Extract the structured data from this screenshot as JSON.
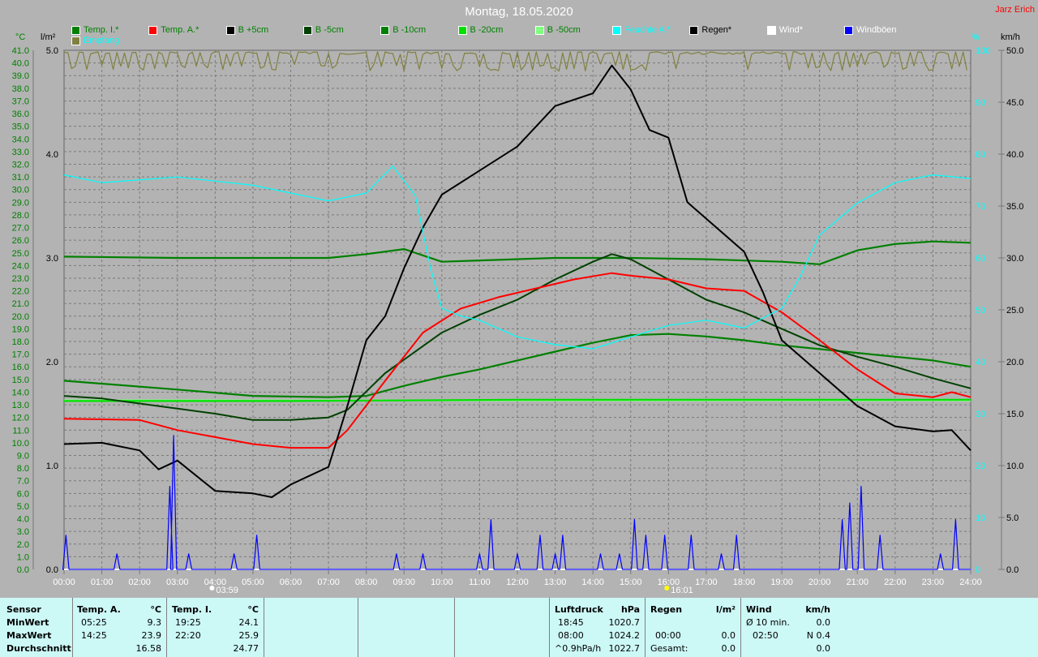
{
  "title": "Montag, 18.05.2020",
  "author": "Jarz Erich",
  "legend": [
    {
      "label": "Temp. I.*",
      "color": "#008000",
      "text_color": "#008000"
    },
    {
      "label": "Temp. A.*",
      "color": "#ff0000",
      "text_color": "#008000"
    },
    {
      "label": "B +5cm",
      "color": "#000000",
      "text_color": "#008000"
    },
    {
      "label": "B -5cm",
      "color": "#004000",
      "text_color": "#008000"
    },
    {
      "label": "B -10cm",
      "color": "#008000",
      "text_color": "#008000"
    },
    {
      "label": "B -20cm",
      "color": "#00e000",
      "text_color": "#008000"
    },
    {
      "label": "B -50cm",
      "color": "#80ff80",
      "text_color": "#008000"
    },
    {
      "label": "Feuchte A.*",
      "color": "#00ffff",
      "text_color": "#00ffff"
    },
    {
      "label": "Regen*",
      "color": "#000000",
      "text_color": "#000000"
    },
    {
      "label": "Wind*",
      "color": "#ffffff",
      "text_color": "#ffffff"
    },
    {
      "label": "Windböen",
      "color": "#0000ff",
      "text_color": "#ffffff"
    },
    {
      "label": "Empfang",
      "color": "#808040",
      "text_color": "#00ffff"
    }
  ],
  "chart_data": {
    "type": "line",
    "title": "Montag, 18.05.2020",
    "xlabel": "",
    "x_ticks": [
      "00:00",
      "01:00",
      "02:00",
      "03:00",
      "04:00",
      "05:00",
      "06:00",
      "07:00",
      "08:00",
      "09:00",
      "10:00",
      "11:00",
      "12:00",
      "13:00",
      "14:00",
      "15:00",
      "16:00",
      "17:00",
      "18:00",
      "19:00",
      "20:00",
      "21:00",
      "22:00",
      "23:00",
      "24:00"
    ],
    "xlim": [
      0,
      24
    ],
    "grid": true,
    "axes": {
      "temp": {
        "unit": "°C",
        "range": [
          0,
          41
        ],
        "step": 1,
        "color": "#008000"
      },
      "rain": {
        "unit": "l/m²",
        "range": [
          0,
          5
        ],
        "step": 1,
        "color": "#000000"
      },
      "humidity": {
        "unit": "%",
        "range": [
          0,
          100
        ],
        "step": 10,
        "color": "#00ffff"
      },
      "wind": {
        "unit": "km/h",
        "range": [
          0,
          50
        ],
        "step": 5,
        "color": "#000000"
      }
    },
    "sun": [
      {
        "label": "03:59",
        "hour": 3.98,
        "type": "sunrise"
      },
      {
        "label": "16:01",
        "hour": 16.02,
        "type": "sunset"
      }
    ],
    "series": [
      {
        "name": "Temp. I.*",
        "axis": "temp",
        "color": "#008000",
        "x": [
          0,
          3,
          6,
          7,
          8,
          9,
          10,
          11,
          13,
          15,
          17,
          19,
          20,
          21,
          22,
          23,
          24
        ],
        "y": [
          24.7,
          24.6,
          24.6,
          24.6,
          24.9,
          25.3,
          24.3,
          24.4,
          24.6,
          24.6,
          24.5,
          24.3,
          24.1,
          25.2,
          25.7,
          25.9,
          25.8
        ]
      },
      {
        "name": "B -50cm",
        "axis": "temp",
        "color": "#80ff80",
        "x": [
          0,
          24
        ],
        "y": [
          13.35,
          13.35
        ]
      },
      {
        "name": "B -20cm",
        "axis": "temp",
        "color": "#00e000",
        "x": [
          0,
          6,
          12,
          18,
          24
        ],
        "y": [
          13.3,
          13.3,
          13.4,
          13.4,
          13.4
        ]
      },
      {
        "name": "B -10cm",
        "axis": "temp",
        "color": "#008000",
        "x": [
          0,
          3,
          5,
          7,
          8,
          9,
          10,
          11,
          12,
          13,
          14,
          15,
          16,
          17,
          18,
          19,
          20,
          21,
          22,
          23,
          24
        ],
        "y": [
          14.9,
          14.2,
          13.7,
          13.6,
          13.7,
          14.5,
          15.2,
          15.8,
          16.5,
          17.2,
          17.9,
          18.5,
          18.6,
          18.4,
          18.1,
          17.7,
          17.4,
          17.1,
          16.8,
          16.5,
          16.0
        ]
      },
      {
        "name": "B -5cm",
        "axis": "temp",
        "color": "#004000",
        "x": [
          0,
          1,
          2,
          4,
          5,
          6,
          7,
          7.5,
          8.5,
          10,
          11,
          12,
          13,
          14,
          14.5,
          15,
          16,
          17,
          18,
          19,
          20,
          21,
          22,
          23,
          24
        ],
        "y": [
          13.7,
          13.5,
          13.1,
          12.3,
          11.8,
          11.8,
          12.0,
          12.6,
          15.5,
          18.7,
          20.1,
          21.3,
          22.9,
          24.3,
          24.9,
          24.5,
          22.9,
          21.3,
          20.3,
          19.0,
          17.7,
          16.8,
          16.0,
          15.1,
          14.3
        ]
      },
      {
        "name": "Temp. A.*",
        "axis": "temp",
        "color": "#ff0000",
        "x": [
          0,
          2,
          3,
          5,
          6,
          7,
          7.5,
          8.5,
          9.5,
          10.5,
          11.5,
          12.5,
          13.5,
          14.5,
          15,
          16,
          17,
          18,
          19,
          20,
          21,
          22,
          23,
          23.5,
          24
        ],
        "y": [
          11.9,
          11.8,
          11.0,
          9.9,
          9.6,
          9.6,
          11.0,
          14.9,
          18.7,
          20.6,
          21.5,
          22.2,
          22.9,
          23.4,
          23.2,
          22.9,
          22.2,
          22.0,
          20.3,
          18.1,
          15.8,
          13.9,
          13.6,
          14.0,
          13.6
        ]
      },
      {
        "name": "B +5cm",
        "axis": "temp",
        "color": "#000000",
        "x": [
          0,
          1,
          2,
          2.5,
          3,
          4,
          5,
          5.5,
          6,
          7,
          7.5,
          8,
          8.5,
          9,
          9.5,
          10,
          11,
          12,
          13,
          14,
          14.5,
          15,
          15.5,
          16,
          16.5,
          17,
          18,
          18.5,
          19,
          20,
          21,
          22,
          23,
          23.5,
          24
        ],
        "y": [
          9.9,
          10.0,
          9.4,
          7.9,
          8.6,
          6.2,
          6.0,
          5.7,
          6.7,
          8.1,
          12.9,
          18.1,
          20.0,
          23.8,
          27.0,
          29.6,
          31.5,
          33.4,
          36.6,
          37.6,
          39.8,
          37.9,
          34.7,
          34.1,
          29.0,
          27.7,
          25.1,
          21.9,
          18.1,
          15.5,
          12.9,
          11.3,
          10.9,
          11.0,
          9.4
        ]
      },
      {
        "name": "Feuchte A.*",
        "axis": "humidity",
        "color": "#00ffff",
        "x": [
          0,
          1,
          3,
          5,
          7,
          8,
          8.7,
          9.3,
          9.7,
          10,
          10.5,
          11,
          12,
          13,
          14,
          15,
          16,
          17,
          18,
          19,
          19.5,
          20,
          21,
          22,
          23,
          24
        ],
        "y": [
          76,
          74.5,
          75.6,
          74,
          71,
          72.5,
          77.7,
          72,
          58,
          50.3,
          48.8,
          48,
          44.8,
          43.3,
          42.5,
          44.8,
          47,
          48,
          46.5,
          50.3,
          56.6,
          64.4,
          70.6,
          74.5,
          76,
          75.3
        ]
      },
      {
        "name": "Regen*",
        "axis": "rain",
        "color": "#000000",
        "x": [
          0,
          24
        ],
        "y": [
          0,
          0
        ]
      },
      {
        "name": "Wind*",
        "axis": "wind",
        "color": "#ffffff",
        "x": [
          0,
          24
        ],
        "y": [
          0,
          0
        ]
      },
      {
        "name": "Windböen",
        "axis": "wind",
        "color": "#0000ff",
        "type": "spikes",
        "x": [
          0.05,
          1.4,
          2.8,
          2.9,
          3.3,
          4.5,
          5.1,
          8.8,
          9.5,
          11.0,
          11.3,
          12.0,
          12.6,
          13.0,
          13.2,
          14.2,
          14.7,
          15.1,
          15.4,
          15.9,
          16.6,
          17.4,
          17.8,
          20.6,
          20.8,
          21.1,
          21.6,
          23.2,
          23.6
        ],
        "y": [
          3.3,
          1.5,
          8.0,
          12.9,
          1.5,
          1.5,
          3.3,
          1.5,
          1.5,
          1.5,
          4.8,
          1.5,
          3.3,
          1.5,
          3.3,
          1.5,
          1.5,
          4.8,
          3.3,
          3.3,
          3.3,
          1.5,
          3.3,
          4.8,
          6.4,
          8.0,
          3.3,
          1.5,
          4.8
        ]
      },
      {
        "name": "Empfang",
        "axis": "humidity",
        "color": "#808040",
        "type": "noise",
        "x": [
          0,
          24
        ],
        "y": [
          96,
          100
        ]
      }
    ]
  },
  "stats": {
    "temp_a": {
      "header": "Sensor",
      "title": "Temp. A.",
      "unit": "°C",
      "rows": [
        {
          "label": "MinWert",
          "time": "05:25",
          "value": "9.3"
        },
        {
          "label": "MaxWert",
          "time": "14:25",
          "value": "23.9"
        },
        {
          "label": "Durchschnitt",
          "time": "",
          "value": "16.58"
        }
      ]
    },
    "temp_i": {
      "title": "Temp. I.",
      "unit": "°C",
      "rows": [
        {
          "time": "19:25",
          "value": "24.1"
        },
        {
          "time": "22:20",
          "value": "25.9"
        },
        {
          "time": "",
          "value": "24.77"
        }
      ]
    },
    "pressure": {
      "title": "Luftdruck",
      "unit": "hPa",
      "rows": [
        {
          "time": "18:45",
          "value": "1020.7"
        },
        {
          "time": "08:00",
          "value": "1024.2"
        },
        {
          "time": "^0.9hPa/h",
          "value": "1022.7"
        }
      ]
    },
    "rain": {
      "title": "Regen",
      "unit": "l/m²",
      "rows": [
        {
          "time": "",
          "value": ""
        },
        {
          "time": "00:00",
          "value": "0.0"
        },
        {
          "time": "Gesamt:",
          "value": "0.0"
        }
      ]
    },
    "wind": {
      "title": "Wind",
      "unit": "km/h",
      "rows": [
        {
          "time": "Ø 10 min.",
          "value": "0.0"
        },
        {
          "time": "02:50",
          "value": "N 0.4"
        },
        {
          "time": "",
          "value": "0.0"
        }
      ]
    }
  }
}
